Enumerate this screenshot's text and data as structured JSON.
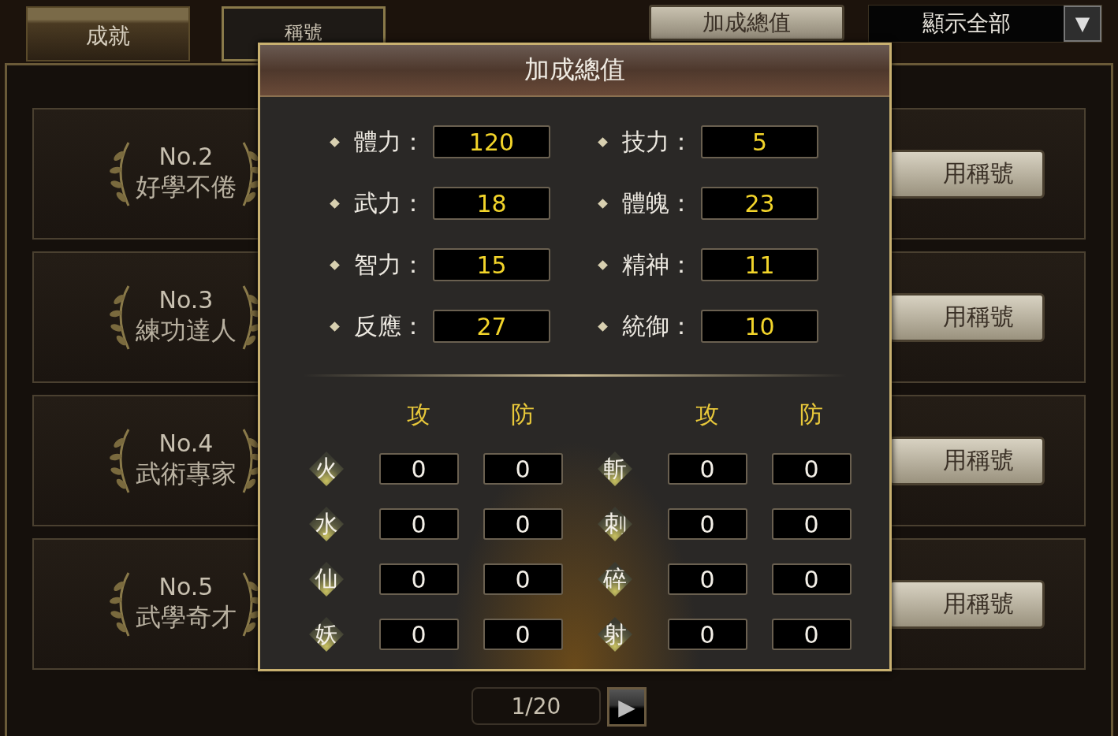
{
  "tabs": [
    {
      "label": "成就",
      "selected": false
    },
    {
      "label": "稱號",
      "selected": true
    }
  ],
  "toolbar": {
    "bonus_button": "加成總值",
    "filter": {
      "value": "顯示全部",
      "caret": "▼"
    }
  },
  "titles": [
    {
      "rank": "No.2",
      "name": "好學不倦",
      "button": "用稱號"
    },
    {
      "rank": "No.3",
      "name": "練功達人",
      "button": "用稱號"
    },
    {
      "rank": "No.4",
      "name": "武術專家",
      "button": "用稱號"
    },
    {
      "rank": "No.5",
      "name": "武學奇才",
      "button": "用稱號"
    }
  ],
  "pager": {
    "page": "1/20",
    "next": "▶"
  },
  "bonus_dialog": {
    "title": "加成總值",
    "stats": [
      {
        "label": "體力：",
        "value": "120"
      },
      {
        "label": "技力：",
        "value": "5"
      },
      {
        "label": "武力：",
        "value": "18"
      },
      {
        "label": "體魄：",
        "value": "23"
      },
      {
        "label": "智力：",
        "value": "15"
      },
      {
        "label": "精神：",
        "value": "11"
      },
      {
        "label": "反應：",
        "value": "27"
      },
      {
        "label": "統御：",
        "value": "10"
      }
    ],
    "element_headers": [
      "攻",
      "防",
      "攻",
      "防"
    ],
    "elements": [
      {
        "label": "火",
        "attack": "0",
        "defense": "0"
      },
      {
        "label": "斬",
        "attack": "0",
        "defense": "0"
      },
      {
        "label": "水",
        "attack": "0",
        "defense": "0"
      },
      {
        "label": "刺",
        "attack": "0",
        "defense": "0"
      },
      {
        "label": "仙",
        "attack": "0",
        "defense": "0"
      },
      {
        "label": "碎",
        "attack": "0",
        "defense": "0"
      },
      {
        "label": "妖",
        "attack": "0",
        "defense": "0"
      },
      {
        "label": "射",
        "attack": "0",
        "defense": "0"
      }
    ]
  }
}
